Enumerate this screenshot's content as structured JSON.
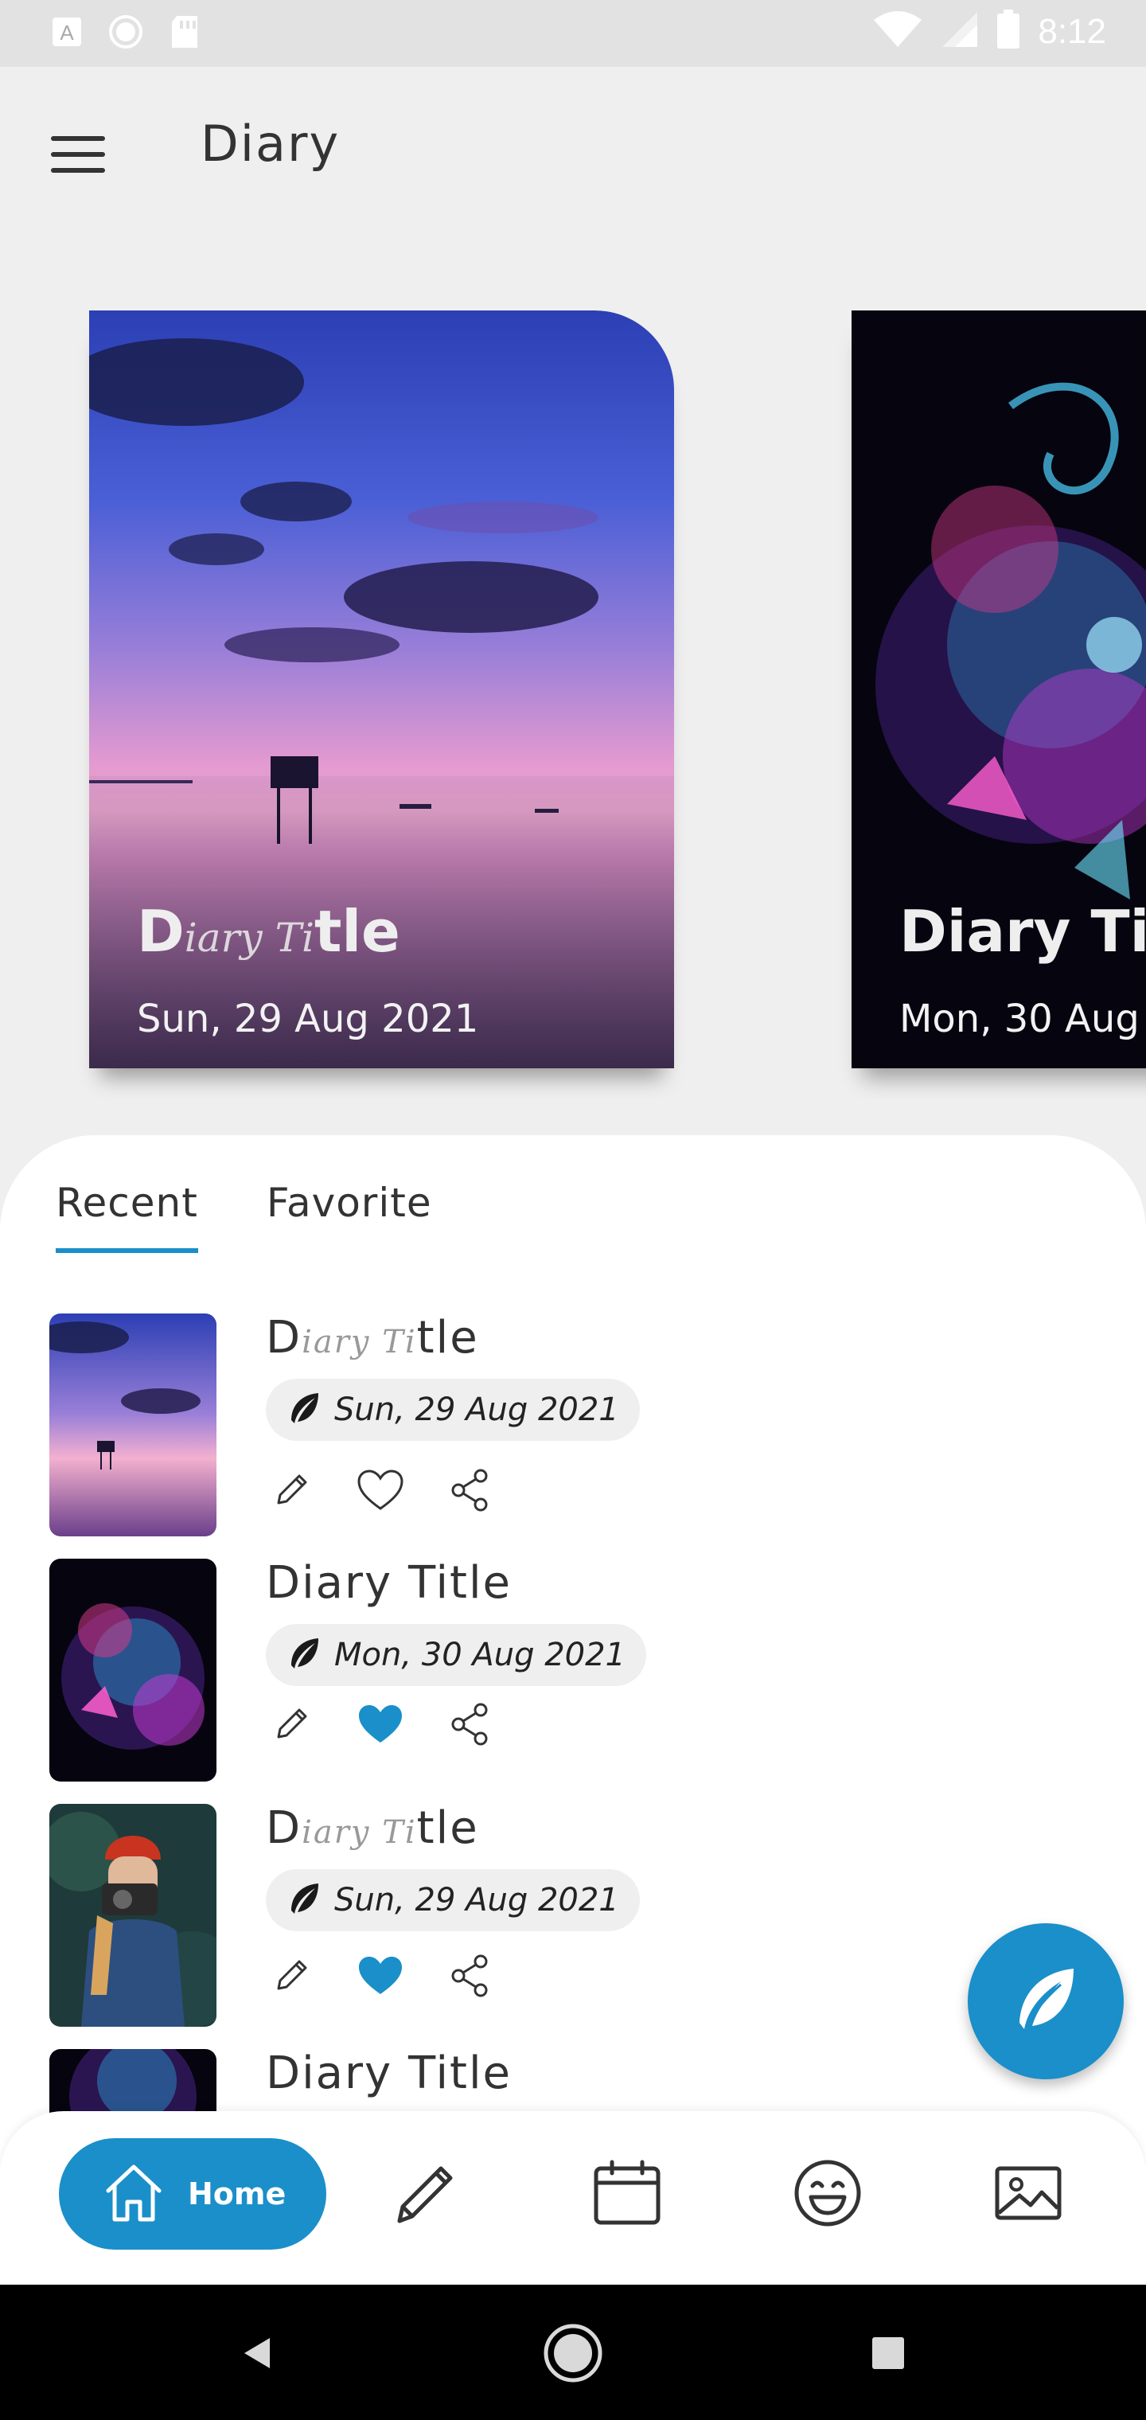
{
  "status_bar": {
    "time": "8:12",
    "icons": [
      "a-box-icon",
      "circle-icon",
      "sd-card-icon",
      "wifi-icon",
      "signal-icon",
      "battery-icon"
    ]
  },
  "app_bar": {
    "title": "Diary",
    "menu_icon": "menu-icon"
  },
  "carousel": [
    {
      "title_prefix": "D",
      "title_script": "iary Ti",
      "title_suffix": "tle",
      "date": "Sun, 29 Aug 2021",
      "art": "sunset-lake"
    },
    {
      "title": "Diary Tit",
      "date": "Mon, 30 Aug",
      "art": "neon-skull"
    }
  ],
  "tabs": [
    "Recent",
    "Favorite"
  ],
  "active_tab": "Recent",
  "entries": [
    {
      "title_prefix": "D",
      "title_script": "iary Ti",
      "title_suffix": "tle",
      "date": "Sun, 29 Aug 2021",
      "favorite": false,
      "thumb": "sunset-lake"
    },
    {
      "title": "Diary Title",
      "date": "Mon, 30 Aug 2021",
      "favorite": true,
      "thumb": "neon-skull"
    },
    {
      "title_prefix": "D",
      "title_script": "iary Ti",
      "title_suffix": "tle",
      "date": "Sun, 29 Aug 2021",
      "favorite": true,
      "thumb": "photographer"
    },
    {
      "title": "Diary Title",
      "thumb": "neon-skull"
    }
  ],
  "bottom_nav": {
    "home_label": "Home",
    "items": [
      "home-icon",
      "pencil-icon",
      "calendar-icon",
      "emoji-icon",
      "image-icon"
    ]
  },
  "colors": {
    "accent": "#1a8fc9",
    "background": "#efefef",
    "sheet": "#ffffff"
  }
}
